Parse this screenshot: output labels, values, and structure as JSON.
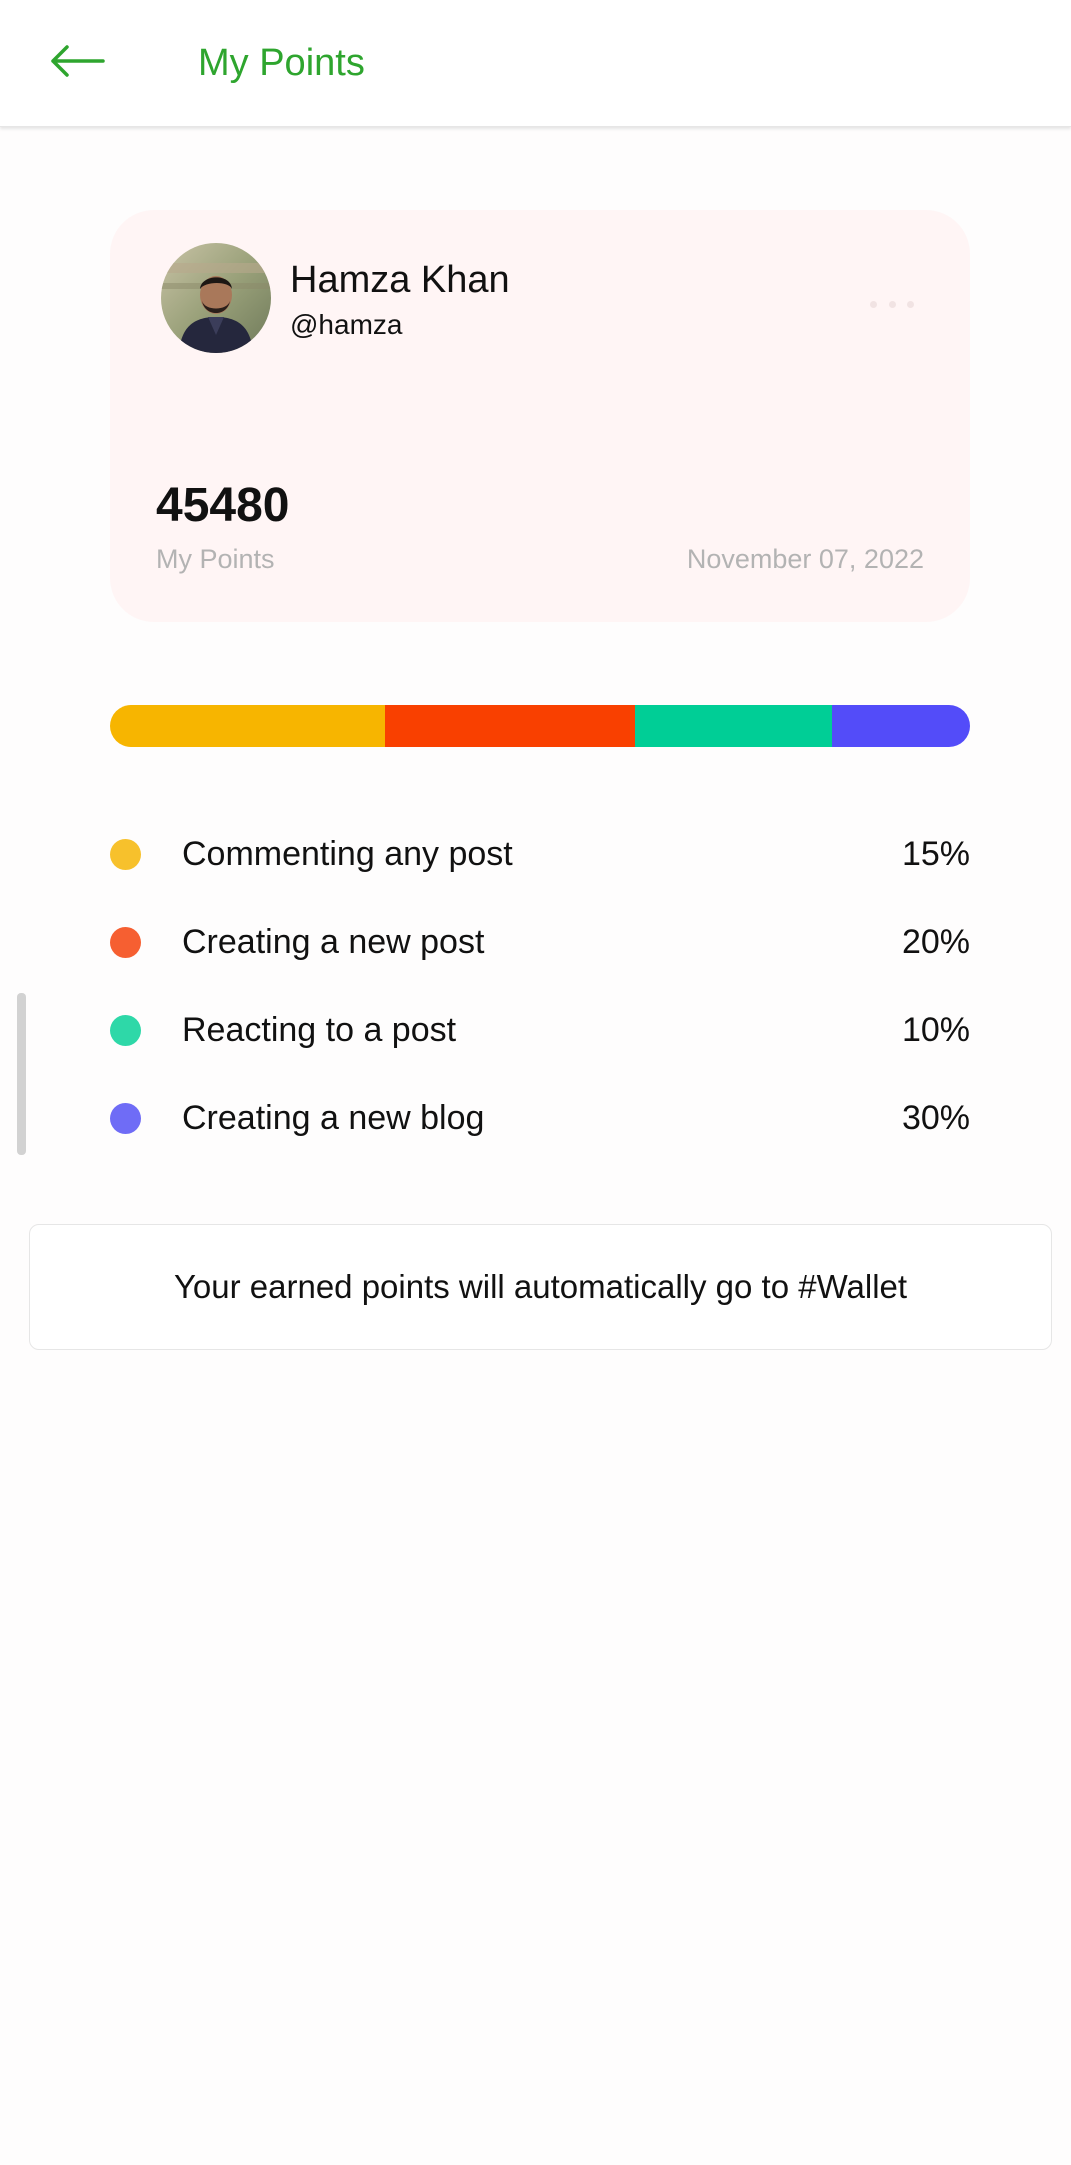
{
  "header": {
    "title": "My Points",
    "back_icon": "arrow-left-icon",
    "accent_color": "#2ea52e"
  },
  "profile": {
    "name": "Hamza Khan",
    "handle": "@hamza",
    "avatar_icon": "user-avatar",
    "more_icon": "more-horizontal-icon"
  },
  "points": {
    "value": "45480",
    "label": "My Points",
    "date": "November 07, 2022"
  },
  "activities": [
    {
      "label": "Commenting any post",
      "percent": "15%",
      "color": "#f7c12c"
    },
    {
      "label": "Creating a new post",
      "percent": "20%",
      "color": "#f65f31"
    },
    {
      "label": "Reacting to a post",
      "percent": "10%",
      "color": "#2ed8a8"
    },
    {
      "label": "Creating a new blog",
      "percent": "30%",
      "color": "#6f6cf6"
    }
  ],
  "progress_bar": {
    "segments": [
      {
        "share": 0.32,
        "color": "#f7b500"
      },
      {
        "share": 0.29,
        "color": "#f94000"
      },
      {
        "share": 0.23,
        "color": "#00ce96"
      },
      {
        "share": 0.16,
        "color": "#534cf9"
      }
    ]
  },
  "info": {
    "message": "Your earned points will automatically go to #Wallet"
  }
}
